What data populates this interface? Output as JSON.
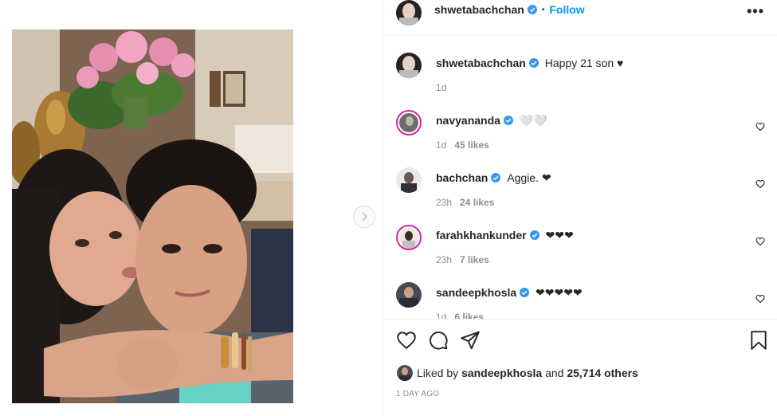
{
  "post": {
    "author": "shwetabachchan",
    "follow_label": "Follow",
    "dot": "•",
    "more_label": "•••"
  },
  "caption": {
    "username": "shwetabachchan",
    "text": "Happy 21 son ♥",
    "time": "1d"
  },
  "comments": [
    {
      "username": "navyananda",
      "text": "🤍🤍",
      "time": "1d",
      "likes": "45 likes"
    },
    {
      "username": "bachchan",
      "text": "Aggie. ❤",
      "time": "23h",
      "likes": "24 likes"
    },
    {
      "username": "farahkhankunder",
      "text": "❤❤❤",
      "time": "23h",
      "likes": "7 likes"
    },
    {
      "username": "sandeepkhosla",
      "text": "❤❤❤❤❤",
      "time": "1d",
      "likes": "6 likes"
    }
  ],
  "likes_line": {
    "prefix": "Liked by",
    "user": "sandeepkhosla",
    "middle": "and",
    "count": "25,714 others"
  },
  "timestamp": "1 DAY AGO",
  "colors": {
    "accent": "#0095f6",
    "verified": "#3897f0",
    "border": "#efefef",
    "muted": "#8e8e8e"
  },
  "icons": {
    "heart": "heart-icon",
    "comment": "comment-icon",
    "share": "share-icon",
    "save": "bookmark-icon",
    "next": "chevron-right-icon"
  }
}
